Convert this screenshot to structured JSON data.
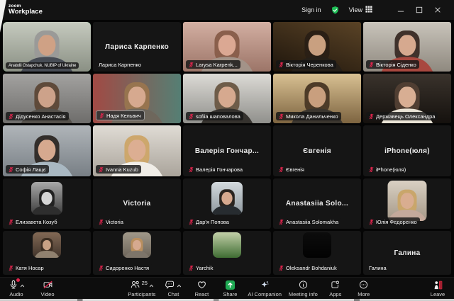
{
  "titlebar": {
    "brand_small": "zoom",
    "brand_large": "Workplace",
    "sign_in": "Sign in",
    "view": "View",
    "icons": [
      "shield-check-icon",
      "grid-view-icon",
      "minimize-icon",
      "maximize-icon",
      "close-icon"
    ]
  },
  "colors": {
    "active_speaker_border": "#2ad15f",
    "muted_mic_red": "#e0254d",
    "share_green": "#1faa53",
    "leave_red": "#d6293e",
    "shield_green": "#1fbf57",
    "titlebar_bg": "#131313",
    "toolbar_bg": "#0d0d0d"
  },
  "participants": [
    {
      "kind": "video",
      "label": "Anatolii Ostapchuk, NUBIP of Ukraine",
      "muted": false,
      "active": true,
      "art": {
        "c1": "#c6cabf",
        "c2": "#8a9084",
        "hair": "#9a9a98",
        "skin": "#cfa185",
        "top": "#474c55"
      }
    },
    {
      "kind": "name",
      "center": "Лариса Карпенко",
      "label": "Лариса Карпенко",
      "muted": false
    },
    {
      "kind": "video",
      "label": "Larysa Karpenk...",
      "muted": true,
      "art": {
        "c1": "#d3afa2",
        "c2": "#9c7568",
        "hair": "#8a5f4c",
        "skin": "#dba893",
        "top": "#a39388"
      }
    },
    {
      "kind": "video",
      "label": "Вікторія Черенкова",
      "muted": true,
      "art": {
        "c1": "#5a4326",
        "c2": "#1e150c",
        "hair": "#2a1f15",
        "skin": "#c9a080",
        "top": "#262019",
        "dir": "200deg"
      }
    },
    {
      "kind": "video",
      "label": "Вікторія Сіденко",
      "muted": true,
      "art": {
        "c1": "#c9c4bb",
        "c2": "#8f897f",
        "hair": "#3f312b",
        "skin": "#d6a98f",
        "top": "#a8483f"
      }
    },
    {
      "kind": "video",
      "label": "Дідусенко Анастасія",
      "muted": true,
      "art": {
        "c1": "#a3a2a0",
        "c2": "#6e6d6b",
        "hair": "#5f4a3a",
        "skin": "#cda28a",
        "top": "#55514b"
      }
    },
    {
      "kind": "video",
      "label": "Надя Кельвич",
      "muted": true,
      "outlined": true,
      "art": {
        "c1": "#a14a44",
        "c2": "#557f74",
        "hair": "#97744f",
        "skin": "#d6a98f",
        "top": "#6e675c",
        "dir": "90deg"
      }
    },
    {
      "kind": "video",
      "label": "sofiia шаповалова",
      "muted": true,
      "art": {
        "c1": "#dddbd6",
        "c2": "#90908c",
        "hair": "#6e5c49",
        "skin": "#d6a98f",
        "top": "#35322e"
      }
    },
    {
      "kind": "video",
      "label": "Микола Данильченко",
      "muted": true,
      "art": {
        "c1": "#d9c193",
        "c2": "#7d6440",
        "hair": "#4d3b28",
        "skin": "#c99f7e",
        "top": "#3b362f"
      }
    },
    {
      "kind": "video",
      "label": "Державець Олександра",
      "muted": true,
      "art": {
        "c1": "#3a332c",
        "c2": "#15110e",
        "hair": "#503e32",
        "skin": "#d8ae93",
        "top": "#e9e3d5"
      }
    },
    {
      "kind": "video",
      "label": "Софія Лащє",
      "muted": true,
      "art": {
        "c1": "#b0b5b9",
        "c2": "#787f85",
        "hair": "#332e2b",
        "skin": "#d6a98f",
        "top": "#a9b8c2"
      }
    },
    {
      "kind": "video",
      "label": "Ivanna Kuzub",
      "muted": true,
      "art": {
        "c1": "#e0dcd5",
        "c2": "#aaa49b",
        "hair": "#cda76c",
        "skin": "#dcae92",
        "top": "#f0ede7"
      }
    },
    {
      "kind": "name",
      "center": "Валерія Гончар...",
      "label": "Валерія Гончарова",
      "muted": true
    },
    {
      "kind": "name",
      "center": "Євгенія",
      "label": "Євгенія",
      "muted": true
    },
    {
      "kind": "name",
      "center": "iPhone(юля)",
      "label": "iPhone(юля)",
      "muted": true
    },
    {
      "kind": "avatar",
      "label": "Елизавета Козуб",
      "muted": true,
      "art": {
        "c1": "#a8a8a8",
        "c2": "#3c3c3c",
        "hair": "#222222",
        "skin": "#d6d6d6",
        "top": "#2e2e2e"
      }
    },
    {
      "kind": "name",
      "center": "Victoria",
      "label": "Victoria",
      "muted": true
    },
    {
      "kind": "avatar",
      "label": "Дар'я Попова",
      "muted": true,
      "art": {
        "c1": "#d4dade",
        "c2": "#8d979d",
        "hair": "#2b2520",
        "skin": "#d6a98f",
        "top": "#272c30"
      }
    },
    {
      "kind": "name",
      "center": "Anastasiia Solo...",
      "label": "Anastasiia Solomakha",
      "muted": true
    },
    {
      "kind": "avatar",
      "size": "lg",
      "label": "Юлія Федоренко",
      "muted": true,
      "art": {
        "c1": "#d9d0c3",
        "c2": "#a59887",
        "hair": "#c9a66b",
        "skin": "#d9ad90",
        "top": "#c4a99b"
      }
    },
    {
      "kind": "avatar",
      "label": "Катя Носар",
      "muted": true,
      "art": {
        "c1": "#826955",
        "c2": "#40332a",
        "hair": "#3d2e22",
        "skin": "#c9a184",
        "top": "#90816f"
      }
    },
    {
      "kind": "avatar",
      "label": "Сидоренко Настя",
      "muted": true,
      "art": {
        "c1": "#a09889",
        "c2": "#6c6459",
        "hair": "#b98f5f",
        "skin": "#d6a98f",
        "top": "#7d756a"
      }
    },
    {
      "kind": "avatar",
      "label": "Yarchik",
      "muted": true,
      "art": {
        "noperson": true,
        "c1": "#c2cfa8",
        "c2": "#3f6d33"
      }
    },
    {
      "kind": "avatar",
      "label": "Oleksandr Bohdaniuk",
      "muted": true,
      "art": {
        "noperson": true,
        "c1": "#0c0c0c",
        "c2": "#020202"
      }
    },
    {
      "kind": "name",
      "center": "Галина",
      "label": "Галина",
      "muted": false
    }
  ],
  "toolbar": {
    "items": [
      {
        "id": "audio",
        "label": "Audio",
        "icon": "mic",
        "caret": true,
        "alert_dot": true,
        "group": "left"
      },
      {
        "id": "video",
        "label": "Video",
        "icon": "camera_off",
        "group": "left"
      },
      {
        "id": "participants",
        "label": "Participants",
        "icon": "people",
        "count": "25",
        "caret": true,
        "group": "center"
      },
      {
        "id": "chat",
        "label": "Chat",
        "icon": "chat",
        "caret": true,
        "group": "center"
      },
      {
        "id": "react",
        "label": "React",
        "icon": "heart",
        "group": "center"
      },
      {
        "id": "share",
        "label": "Share",
        "icon": "share",
        "group": "center"
      },
      {
        "id": "ai-companion",
        "label": "AI Companion",
        "icon": "sparkle",
        "group": "center"
      },
      {
        "id": "meeting-info",
        "label": "Meeting info",
        "icon": "info",
        "group": "center"
      },
      {
        "id": "apps",
        "label": "Apps",
        "icon": "apps",
        "group": "center"
      },
      {
        "id": "more",
        "label": "More",
        "icon": "more",
        "group": "center"
      },
      {
        "id": "leave",
        "label": "Leave",
        "icon": "leave",
        "group": "right"
      }
    ]
  }
}
